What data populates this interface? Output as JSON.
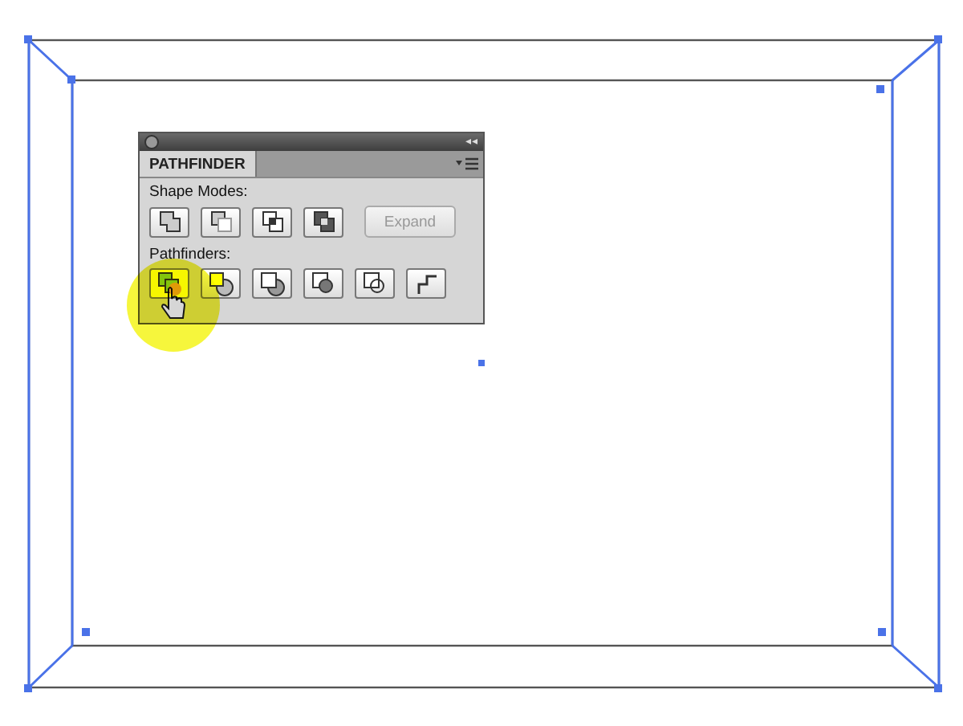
{
  "panel": {
    "tab": "PATHFINDER",
    "collapse_glyph": "◂◂",
    "shape_modes": {
      "label": "Shape Modes:",
      "buttons": [
        {
          "kind": "unite"
        },
        {
          "kind": "minus-front"
        },
        {
          "kind": "intersect"
        },
        {
          "kind": "exclude"
        }
      ],
      "expand": {
        "label": "Expand",
        "disabled": true
      }
    },
    "pathfinders": {
      "label": "Pathfinders:",
      "buttons": [
        {
          "kind": "divide",
          "selected": true
        },
        {
          "kind": "trim",
          "selected": false
        },
        {
          "kind": "merge",
          "selected": false
        },
        {
          "kind": "crop",
          "selected": false
        },
        {
          "kind": "outline",
          "selected": false
        },
        {
          "kind": "minus-back",
          "selected": false
        }
      ]
    }
  }
}
